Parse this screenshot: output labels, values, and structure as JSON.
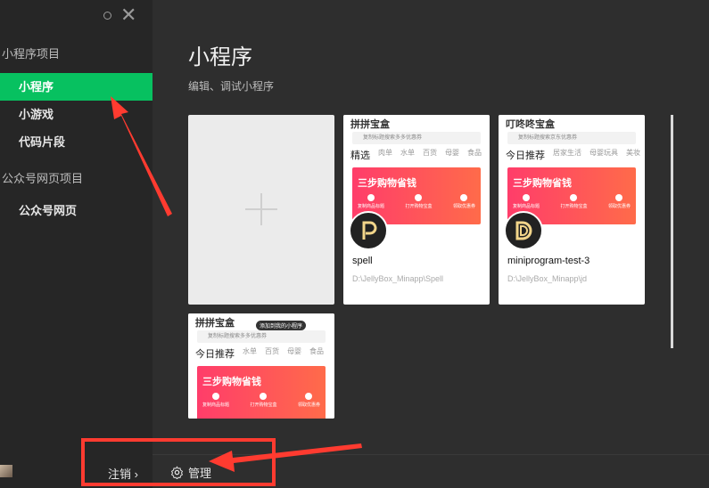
{
  "sidebar": {
    "section1_title": "小程序项目",
    "section2_title": "公众号网页项目",
    "items": [
      {
        "label": "小程序"
      },
      {
        "label": "小游戏"
      },
      {
        "label": "代码片段"
      },
      {
        "label": "公众号网页"
      }
    ],
    "logout_label": "注销",
    "logout_chevron": "›"
  },
  "main": {
    "title": "小程序",
    "subtitle": "编辑、调试小程序",
    "manage_label": "管理"
  },
  "projects": [
    {
      "name": "spell",
      "path": "D:\\JellyBox_Minapp\\Spell",
      "thumb_header": "拼拼宝盒",
      "thumb_search": "复制标题搜索多多优惠券",
      "thumb_tabs": [
        "精选",
        "肉单",
        "水单",
        "百货",
        "母婴",
        "食品"
      ],
      "banner_title": "三步购物省钱",
      "banner_steps": [
        "复制商品标题",
        "打开购物宝盒",
        "领取优惠券"
      ]
    },
    {
      "name": "miniprogram-test-3",
      "path": "D:\\JellyBox_Minapp\\jd",
      "thumb_header": "叮咚咚宝盒",
      "thumb_search": "复制标题搜索京东优惠券",
      "thumb_tabs": [
        "今日推荐",
        "居家生活",
        "母婴玩具",
        "美妆"
      ],
      "banner_title": "三步购物省钱",
      "banner_steps": [
        "复制商品标题",
        "打开购物宝盒",
        "领取优惠券"
      ]
    },
    {
      "thumb_header": "拼拼宝盒",
      "thumb_badge": "添加到我的小程序",
      "thumb_search": "复制标题搜索多多优惠券",
      "thumb_tabs": [
        "今日推荐",
        "水单",
        "百货",
        "母婴",
        "食品"
      ],
      "banner_title": "三步购物省钱",
      "banner_steps": [
        "复制商品标题",
        "打开购物宝盒",
        "领取优惠券"
      ]
    }
  ],
  "colors": {
    "accent": "#07c160",
    "annotation": "#ff3b30"
  }
}
